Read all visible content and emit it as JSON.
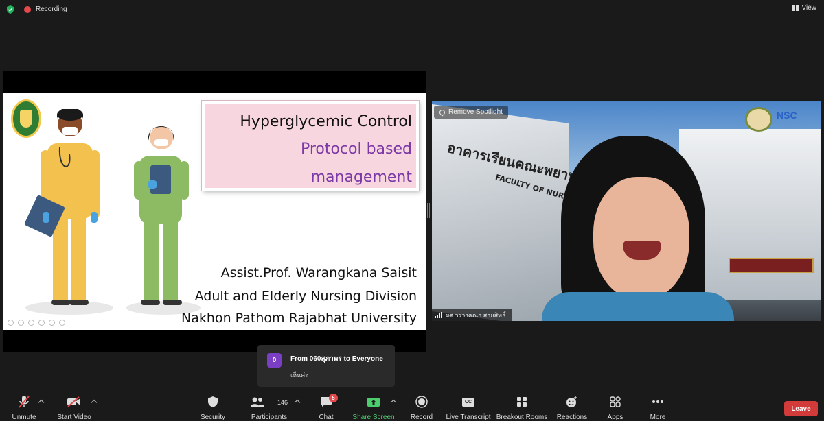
{
  "top_bar": {
    "recording_label": "Recording",
    "view_label": "View"
  },
  "slide": {
    "title_lines": [
      "Hyperglycemic Control",
      "Protocol based",
      "management"
    ],
    "author_lines": [
      "Assist.Prof. Warangkana  Saisit",
      "Adult and Elderly Nursing Division",
      "Nakhon Pathom Rajabhat University"
    ]
  },
  "spotlight": {
    "remove_spotlight_label": "Remove Spotlight",
    "participant_name": "ผศ.วรางคณา สายสิทธิ์",
    "logo_text": "NSC",
    "building_sign": "อาคารเรียนคณะพยาบาล",
    "building_sign_en": "FACULTY OF NURSING"
  },
  "chat_notification": {
    "avatar_letter": "0",
    "from_line": "From 060สุภาพร to Everyone",
    "message": "เห็นค่ะ"
  },
  "toolbar": {
    "unmute": "Unmute",
    "start_video": "Start Video",
    "security": "Security",
    "participants": "Participants",
    "participants_count": "146",
    "chat": "Chat",
    "chat_badge": "5",
    "share_screen": "Share Screen",
    "record": "Record",
    "live_transcript": "Live Transcript",
    "cc_label": "CC",
    "breakout_rooms": "Breakout Rooms",
    "reactions": "Reactions",
    "apps": "Apps",
    "more": "More",
    "leave": "Leave"
  },
  "colors": {
    "background": "#1a1a1a",
    "leave_red": "#d33b3b",
    "share_green": "#4ccd6e",
    "recording_red": "#e5484d",
    "slide_title_purple": "#7b3aa5",
    "slide_title_box": "#f7d6df"
  }
}
